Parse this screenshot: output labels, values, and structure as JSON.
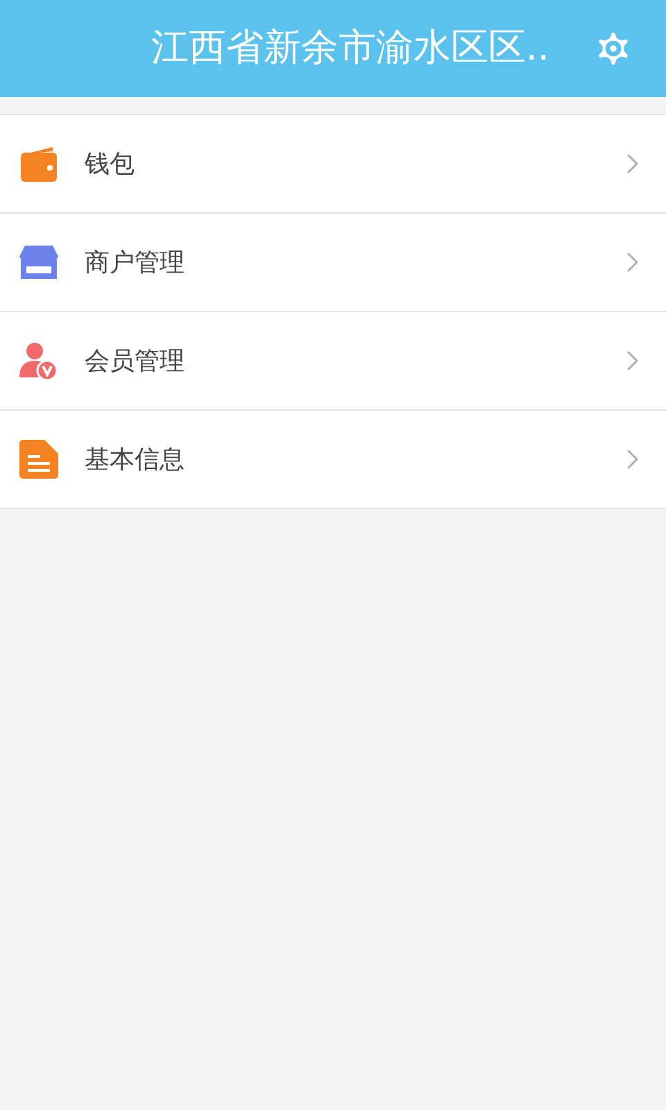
{
  "header": {
    "title": "江西省新余市渝水区区.."
  },
  "menu": [
    {
      "kind": "wallet",
      "label": "钱包"
    },
    {
      "kind": "store",
      "label": "商户管理"
    },
    {
      "kind": "member",
      "label": "会员管理"
    },
    {
      "kind": "document",
      "label": "基本信息"
    }
  ]
}
